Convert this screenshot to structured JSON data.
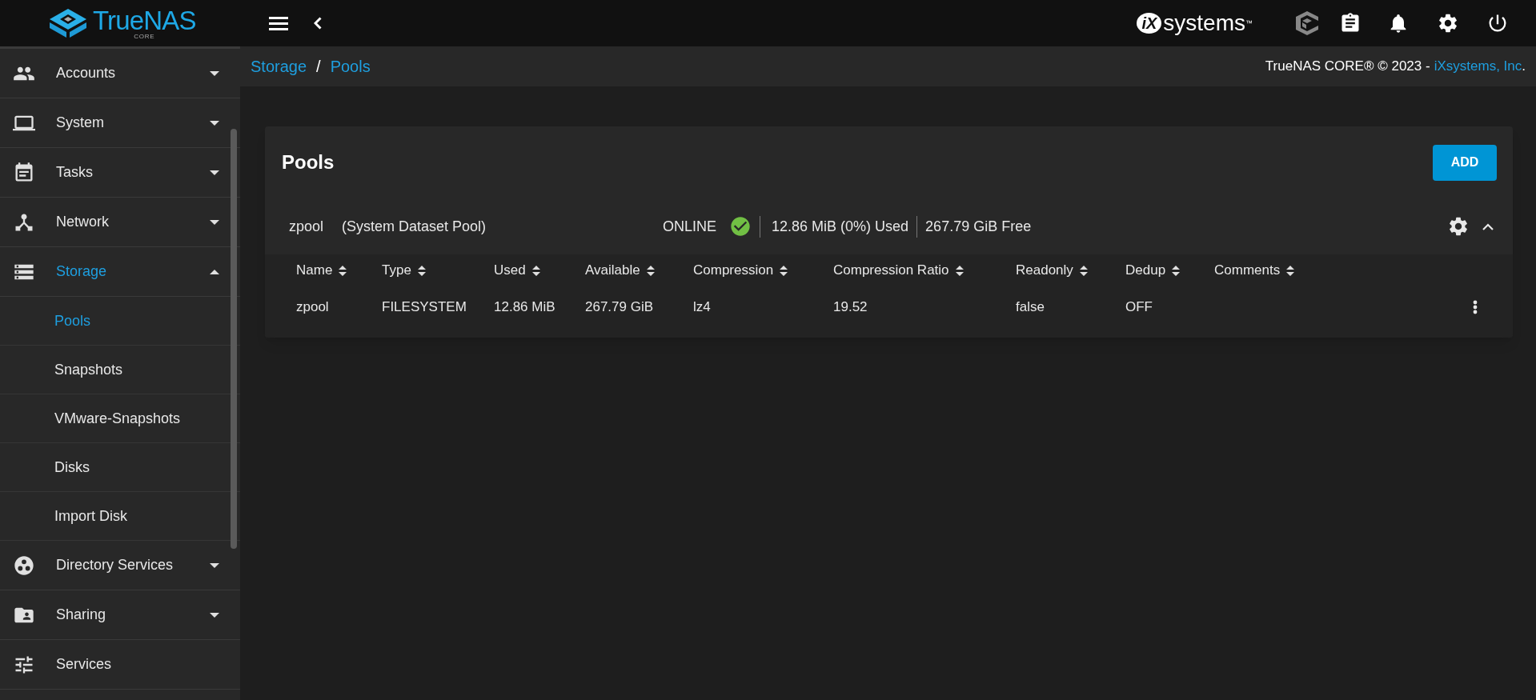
{
  "topbar": {
    "logo_text": "TrueNAS",
    "logo_subtext": "CORE",
    "vendor_logo_mark": "iX",
    "vendor_logo_text": "systems",
    "vendor_logo_tm": "™"
  },
  "sidebar": {
    "items": [
      {
        "label": "Accounts",
        "kind": "group",
        "expanded": false,
        "selected": false
      },
      {
        "label": "System",
        "kind": "group",
        "expanded": false,
        "selected": false
      },
      {
        "label": "Tasks",
        "kind": "group",
        "expanded": false,
        "selected": false
      },
      {
        "label": "Network",
        "kind": "group",
        "expanded": false,
        "selected": false
      },
      {
        "label": "Storage",
        "kind": "group",
        "expanded": true,
        "selected": true,
        "children": [
          {
            "label": "Pools",
            "selected": true
          },
          {
            "label": "Snapshots",
            "selected": false
          },
          {
            "label": "VMware-Snapshots",
            "selected": false
          },
          {
            "label": "Disks",
            "selected": false
          },
          {
            "label": "Import Disk",
            "selected": false
          }
        ]
      },
      {
        "label": "Directory Services",
        "kind": "group",
        "expanded": false,
        "selected": false
      },
      {
        "label": "Sharing",
        "kind": "group",
        "expanded": false,
        "selected": false
      },
      {
        "label": "Services",
        "kind": "link",
        "expanded": false,
        "selected": false
      }
    ]
  },
  "breadcrumb": [
    "Storage",
    "Pools"
  ],
  "breadcrumb_separator": "/",
  "copyright": {
    "text": "TrueNAS CORE® © 2023 -",
    "link": "iXsystems, Inc",
    "end": "."
  },
  "card": {
    "title": "Pools",
    "add_button": "ADD",
    "pool": {
      "name": "zpool",
      "note": "(System Dataset Pool)",
      "status": "ONLINE",
      "healthy": true,
      "used": "12.86 MiB (0%) Used",
      "free": "267.79 GiB Free",
      "expanded": true,
      "table": {
        "columns": [
          "Name",
          "Type",
          "Used",
          "Available",
          "Compression",
          "Compression Ratio",
          "Readonly",
          "Dedup",
          "Comments"
        ],
        "rows": [
          [
            "zpool",
            "FILESYSTEM",
            "12.86 MiB",
            "267.79 GiB",
            "lz4",
            "19.52",
            "false",
            "OFF",
            ""
          ]
        ]
      }
    }
  }
}
